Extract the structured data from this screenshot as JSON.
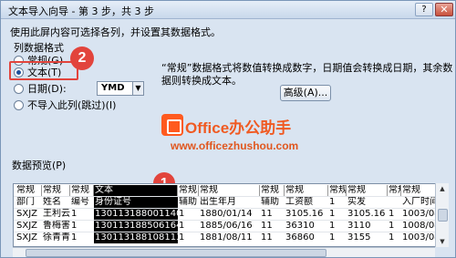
{
  "window": {
    "title": "文本导入向导 - 第 3 步，共 3 步",
    "help_label": "?",
    "close_label": "✕"
  },
  "instruction": "使用此屏内容可选择各列，并设置其数据格式。",
  "column_format": {
    "group_label": "列数据格式",
    "options": [
      {
        "label": "常规(G)",
        "checked": false
      },
      {
        "label": "文本(T)",
        "checked": true
      },
      {
        "label": "日期(D):",
        "checked": false
      },
      {
        "label": "不导入此列(跳过)(I)",
        "checked": false
      }
    ],
    "date_format": "YMD"
  },
  "description": "“常规”数据格式将数值转换成数字，日期值会转换成日期，其余数据则转换成文本。",
  "advanced_button": "高级(A)...",
  "watermark": {
    "title": "Office办公助手",
    "url": "www.officezhushou.com"
  },
  "annotations": {
    "badge1": "1",
    "badge2": "2"
  },
  "preview": {
    "label": "数据预览(P)",
    "header": [
      "常规",
      "常规",
      "常规",
      "文本",
      "常规",
      "常规",
      "常规",
      "常规",
      "常规",
      "常规",
      "常规",
      "常规",
      "常规"
    ],
    "rows": [
      [
        "部门",
        "姓名",
        "编号",
        "身份证号",
        "辅助",
        "出生年月",
        "辅助",
        "工资额",
        "1",
        "实发",
        "",
        "入厂时间",
        ""
      ],
      [
        "SXJZ",
        "王利云",
        "1",
        "130113188001140046",
        "1",
        "1880/01/14",
        "11",
        "3105.16",
        "1",
        "3105.16",
        "1",
        "1003/08/01",
        ""
      ],
      [
        "SXJZ",
        "鲁梅害",
        "1",
        "130113188506164548",
        "1",
        "1885/06/16",
        "11",
        "36310",
        "1",
        "3110",
        "1",
        "1008/08/01",
        ""
      ],
      [
        "SXJZ",
        "徐青青",
        "1",
        "130113188108113314",
        "1",
        "1881/08/11",
        "11",
        "36860",
        "1",
        "3155",
        "1",
        "1003/08/01",
        ""
      ]
    ]
  }
}
